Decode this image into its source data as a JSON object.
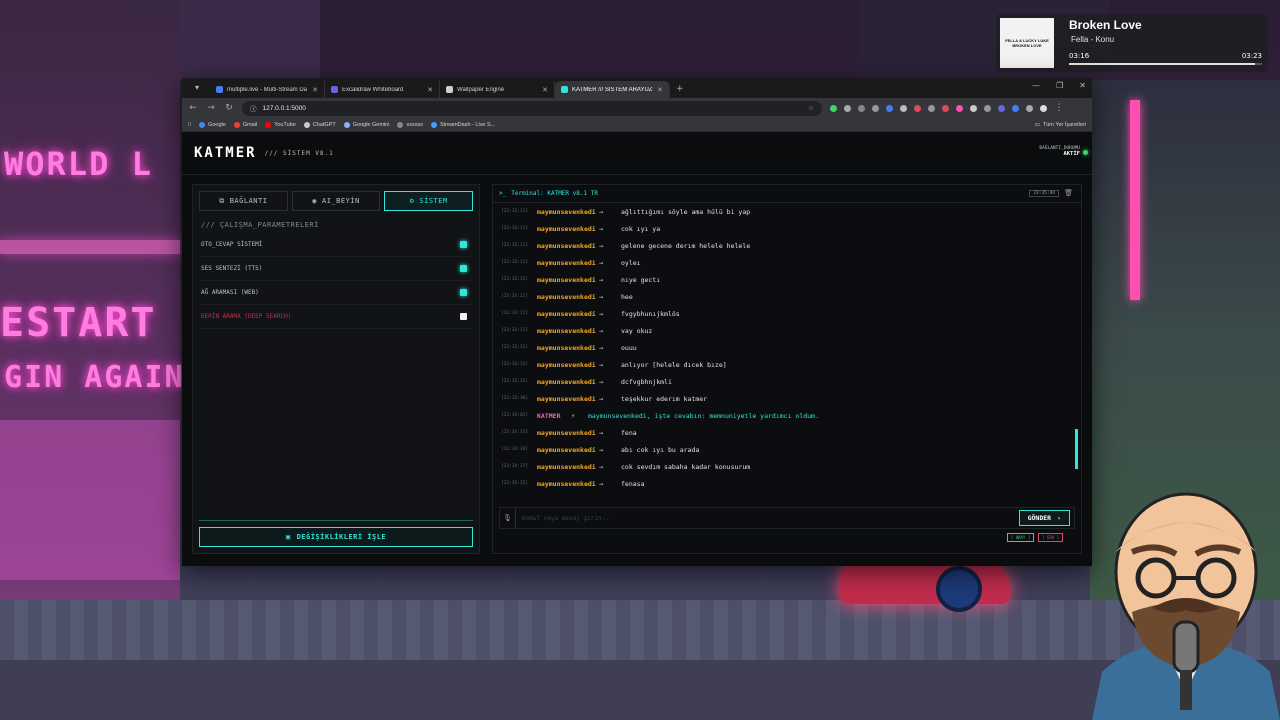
{
  "wallpaper": {
    "sign_top": "WORLD L",
    "sign_mid": "ESTART",
    "sign_low": "GIN AGAIN"
  },
  "now_playing": {
    "title": "Broken Love",
    "artist": "Fella - Konu",
    "elapsed": "03:16",
    "duration": "03:23",
    "progress": 0.965,
    "album_art_text": "FELLA & LUCKY LUKE BROKEN LOVE"
  },
  "browser": {
    "tabs": [
      {
        "label": "multiple.live - Multi-Stream Da",
        "color": "#4a7bf7"
      },
      {
        "label": "Excalidraw Whiteboard",
        "color": "#6965db"
      },
      {
        "label": "Wallpaper Engine",
        "color": "#cfcfcf"
      },
      {
        "label": "KATMER /// SİSTEM ARAYÜZÜ",
        "color": "#2fe6d8"
      }
    ],
    "url": "127.0.0.1:5000",
    "bookmarks": [
      {
        "label": "Google",
        "color": "#4285f4"
      },
      {
        "label": "Gmail",
        "color": "#ea4335"
      },
      {
        "label": "YouTube",
        "color": "#ff0000"
      },
      {
        "label": "ChatGPT",
        "color": "#cccccc"
      },
      {
        "label": "Google Gemini",
        "color": "#8ab4f8"
      },
      {
        "label": "ssssss",
        "color": "#888888"
      },
      {
        "label": "StreamDash - Live S...",
        "color": "#3aa0ff"
      }
    ],
    "all_bookmarks": "Tüm Yer İşaretleri"
  },
  "app": {
    "logo": "KATMER",
    "logo_sub": "/// SİSTEM V8.1",
    "status_label": "BAĞLANTI_DURUMU",
    "status_value": "AKTİF",
    "tabs": [
      {
        "label": "BAĞLANTI",
        "icon": "network-icon"
      },
      {
        "label": "AI_BEYİN",
        "icon": "brain-icon"
      },
      {
        "label": "SİSTEM",
        "icon": "gears-icon"
      }
    ],
    "params_title": "/// ÇALIŞMA_PARAMETRELERİ",
    "params": [
      {
        "label": "OTO_CEVAP SİSTEMİ",
        "enabled": true
      },
      {
        "label": "SES SENTEZİ (TTS)",
        "enabled": true
      },
      {
        "label": "AĞ ARAMASI (WEB)",
        "enabled": true
      },
      {
        "label": "DERİN ARAMA (DEEP SEARCH)",
        "enabled": false
      }
    ],
    "apply_label": "DEĞİŞİKLİKLERİ İŞLE",
    "terminal_title": "Terminal: KATMER v8.1 TR",
    "terminal_time": "23:35:44",
    "messages": [
      {
        "ts": "[23:33:11]",
        "user": "maymunsevenkedi",
        "text": "ağlıttığımı söyle ama hülü bi yap"
      },
      {
        "ts": "[23:33:11]",
        "user": "maymunsevenkedi",
        "text": "cok ıyı ya"
      },
      {
        "ts": "[23:33:11]",
        "user": "maymunsevenkedi",
        "text": "gelene gecene derım helele helele"
      },
      {
        "ts": "[23:33:11]",
        "user": "maymunsevenkedi",
        "text": "oyleı"
      },
      {
        "ts": "[23:33:11]",
        "user": "maymunsevenkedi",
        "text": "nıye gectı"
      },
      {
        "ts": "[23:33:21]",
        "user": "maymunsevenkedi",
        "text": "hee"
      },
      {
        "ts": "[23:33:21]",
        "user": "maymunsevenkedi",
        "text": "fvgybhunıjkmlös"
      },
      {
        "ts": "[23:33:21]",
        "user": "maymunsevenkedi",
        "text": "vay okuz"
      },
      {
        "ts": "[23:33:31]",
        "user": "maymunsevenkedi",
        "text": "ouuu"
      },
      {
        "ts": "[23:33:31]",
        "user": "maymunsevenkedi",
        "text": "anlıyor [helele dıcek bıze]"
      },
      {
        "ts": "[23:33:31]",
        "user": "maymunsevenkedi",
        "text": "dcfvgbhnjkmli"
      },
      {
        "ts": "[23:33:36]",
        "user": "maymunsevenkedi",
        "text": "teşekkur ederım katmer"
      },
      {
        "ts": "[23:34:03]",
        "user": "KATMER",
        "bot": true,
        "text": "maymunsevenkedi, işte cevabın: memnuniyetle yardımcı oldum."
      },
      {
        "ts": "[23:34:31]",
        "user": "maymunsevenkedi",
        "text": "fena"
      },
      {
        "ts": "[23:34:34]",
        "user": "maymunsevenkedi",
        "text": "abı cok ıyı bu arada"
      },
      {
        "ts": "[23:34:37]",
        "user": "maymunsevenkedi",
        "text": "cok sevdım sabaha kadar konusurum"
      },
      {
        "ts": "[23:35:25]",
        "user": "maymunsevenkedi",
        "text": "fenasa"
      }
    ],
    "input_placeholder": "Komut veya mesaj girin...",
    "send_label": "GÖNDER",
    "mini_ok": "[ OKAY ]",
    "mini_err": "[ ERR ]"
  }
}
